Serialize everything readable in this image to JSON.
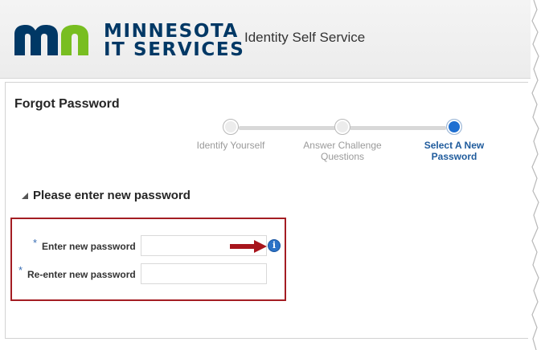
{
  "header": {
    "brand_line1": "MINNESOTA",
    "brand_line2": "IT SERVICES",
    "app_title": "Identity Self Service"
  },
  "page": {
    "title": "Forgot Password"
  },
  "train": {
    "steps": [
      {
        "label": "Identify Yourself",
        "state": "visited"
      },
      {
        "label": "Answer Challenge Questions",
        "state": "visited"
      },
      {
        "label": "Select A New Password",
        "state": "current"
      }
    ]
  },
  "section": {
    "title": "Please enter new password"
  },
  "form": {
    "required_marker": "*",
    "new_password_label": "Enter new password",
    "new_password_value": "",
    "reenter_password_label": "Re-enter new password",
    "reenter_password_value": ""
  },
  "icons": {
    "info": "info-icon",
    "arrow": "red-arrow-icon",
    "toggle": "expand-triangle-icon"
  },
  "colors": {
    "brand_navy": "#003865",
    "brand_green": "#78be21",
    "highlight_red": "#a41d23",
    "active_step": "#1f6fd1",
    "info_blue": "#2c72c7"
  }
}
